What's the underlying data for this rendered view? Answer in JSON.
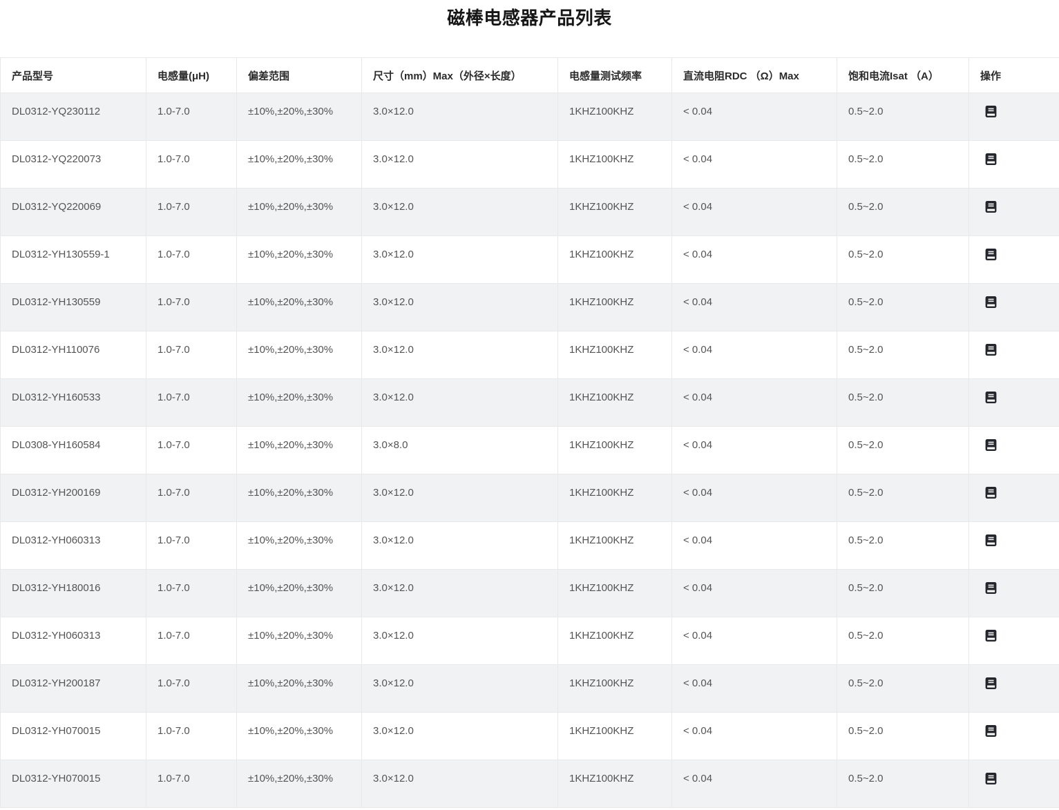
{
  "page": {
    "title": "磁棒电感器产品列表"
  },
  "table": {
    "headers": [
      "产品型号",
      "电感量(μH)",
      "偏差范围",
      "尺寸（mm）Max（外径×长度）",
      "电感量测试频率",
      "直流电阻RDC （Ω）Max",
      "饱和电流Isat （A）",
      "操作"
    ],
    "action_icon": "notebook-icon",
    "rows": [
      {
        "model": "DL0312-YQ230112",
        "inductance": "1.0-7.0",
        "tolerance": "±10%,±20%,±30%",
        "size": "3.0×12.0",
        "frequency": "1KHZ100KHZ",
        "rdc": "< 0.04",
        "isat": "0.5~2.0"
      },
      {
        "model": "DL0312-YQ220073",
        "inductance": "1.0-7.0",
        "tolerance": "±10%,±20%,±30%",
        "size": "3.0×12.0",
        "frequency": "1KHZ100KHZ",
        "rdc": "< 0.04",
        "isat": "0.5~2.0"
      },
      {
        "model": "DL0312-YQ220069",
        "inductance": "1.0-7.0",
        "tolerance": "±10%,±20%,±30%",
        "size": "3.0×12.0",
        "frequency": "1KHZ100KHZ",
        "rdc": "< 0.04",
        "isat": "0.5~2.0"
      },
      {
        "model": "DL0312-YH130559-1",
        "inductance": "1.0-7.0",
        "tolerance": "±10%,±20%,±30%",
        "size": "3.0×12.0",
        "frequency": "1KHZ100KHZ",
        "rdc": "< 0.04",
        "isat": "0.5~2.0"
      },
      {
        "model": "DL0312-YH130559",
        "inductance": "1.0-7.0",
        "tolerance": "±10%,±20%,±30%",
        "size": "3.0×12.0",
        "frequency": "1KHZ100KHZ",
        "rdc": "< 0.04",
        "isat": "0.5~2.0"
      },
      {
        "model": "DL0312-YH110076",
        "inductance": "1.0-7.0",
        "tolerance": "±10%,±20%,±30%",
        "size": "3.0×12.0",
        "frequency": "1KHZ100KHZ",
        "rdc": "< 0.04",
        "isat": "0.5~2.0"
      },
      {
        "model": "DL0312-YH160533",
        "inductance": "1.0-7.0",
        "tolerance": "±10%,±20%,±30%",
        "size": "3.0×12.0",
        "frequency": "1KHZ100KHZ",
        "rdc": "< 0.04",
        "isat": "0.5~2.0"
      },
      {
        "model": "DL0308-YH160584",
        "inductance": "1.0-7.0",
        "tolerance": "±10%,±20%,±30%",
        "size": "3.0×8.0",
        "frequency": "1KHZ100KHZ",
        "rdc": "< 0.04",
        "isat": "0.5~2.0"
      },
      {
        "model": "DL0312-YH200169",
        "inductance": "1.0-7.0",
        "tolerance": "±10%,±20%,±30%",
        "size": "3.0×12.0",
        "frequency": "1KHZ100KHZ",
        "rdc": "< 0.04",
        "isat": "0.5~2.0"
      },
      {
        "model": "DL0312-YH060313",
        "inductance": "1.0-7.0",
        "tolerance": "±10%,±20%,±30%",
        "size": "3.0×12.0",
        "frequency": "1KHZ100KHZ",
        "rdc": "< 0.04",
        "isat": "0.5~2.0"
      },
      {
        "model": "DL0312-YH180016",
        "inductance": "1.0-7.0",
        "tolerance": "±10%,±20%,±30%",
        "size": "3.0×12.0",
        "frequency": "1KHZ100KHZ",
        "rdc": "< 0.04",
        "isat": "0.5~2.0"
      },
      {
        "model": "DL0312-YH060313",
        "inductance": "1.0-7.0",
        "tolerance": "±10%,±20%,±30%",
        "size": "3.0×12.0",
        "frequency": "1KHZ100KHZ",
        "rdc": "< 0.04",
        "isat": "0.5~2.0"
      },
      {
        "model": "DL0312-YH200187",
        "inductance": "1.0-7.0",
        "tolerance": "±10%,±20%,±30%",
        "size": "3.0×12.0",
        "frequency": "1KHZ100KHZ",
        "rdc": "< 0.04",
        "isat": "0.5~2.0"
      },
      {
        "model": "DL0312-YH070015",
        "inductance": "1.0-7.0",
        "tolerance": "±10%,±20%,±30%",
        "size": "3.0×12.0",
        "frequency": "1KHZ100KHZ",
        "rdc": "< 0.04",
        "isat": "0.5~2.0"
      },
      {
        "model": "DL0312-YH070015",
        "inductance": "1.0-7.0",
        "tolerance": "±10%,±20%,±30%",
        "size": "3.0×12.0",
        "frequency": "1KHZ100KHZ",
        "rdc": "< 0.04",
        "isat": "0.5~2.0"
      }
    ]
  },
  "colors": {
    "stripe_row_bg": "#f1f2f4",
    "table_border": "#e7e8ea",
    "header_text": "#2b2b2b",
    "body_text": "#545454",
    "icon_fill": "#23262c"
  }
}
